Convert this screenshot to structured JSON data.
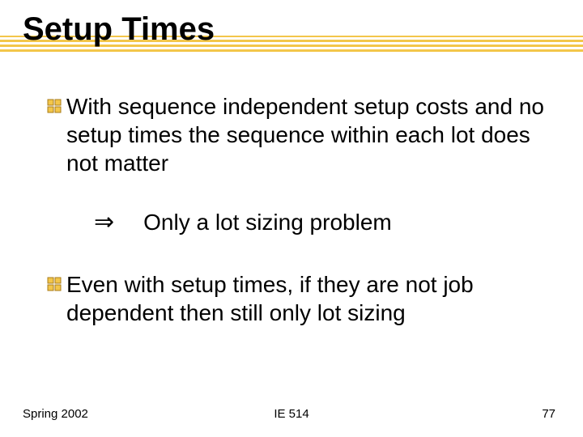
{
  "title": "Setup Times",
  "bullets": [
    {
      "text": "With sequence independent setup costs and no setup times the sequence within each lot does not matter"
    },
    {
      "text": "Even with setup times, if they are not job dependent then still only lot sizing"
    }
  ],
  "implication": {
    "symbol": "⇒",
    "text": "Only a lot sizing problem"
  },
  "footer": {
    "left": "Spring 2002",
    "center": "IE 514",
    "right": "77"
  },
  "colors": {
    "accent": "#f3c64a",
    "bullet_fill": "#f3c64a",
    "bullet_stroke": "#a97c1a"
  }
}
